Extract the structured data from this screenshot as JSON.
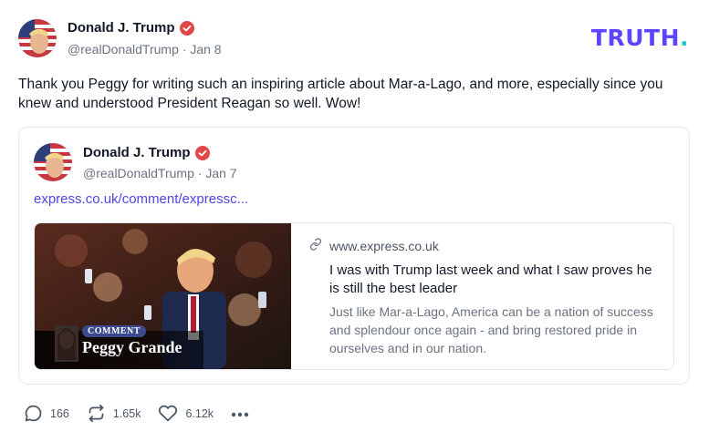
{
  "author": {
    "name": "Donald J. Trump",
    "handle": "@realDonaldTrump",
    "separator": "·",
    "date": "Jan 8"
  },
  "logo": {
    "text": "TRUTH",
    "dot": "."
  },
  "post_text": "Thank you Peggy for writing such an inspiring article about Mar-a-Lago, and more, especially since you knew and understood President Reagan so well. Wow!",
  "quoted_post": {
    "author_name": "Donald J. Trump",
    "handle": "@realDonaldTrump",
    "separator": "·",
    "date": "Jan 7",
    "link_text": "express.co.uk/comment/expressc...",
    "link_card": {
      "badge": "COMMENT",
      "byline": "Peggy Grande",
      "domain": "www.express.co.uk",
      "title": "I was with Trump last week and what I saw proves he is still the best leader",
      "description": "Just like Mar-a-Lago, America can be a nation of success and splendour once again - and bring restored pride in ourselves and in our nation."
    }
  },
  "actions": {
    "replies": "166",
    "retruths": "1.65k",
    "likes": "6.12k"
  },
  "colors": {
    "logo": "#5b45ff",
    "logo_dot": "#22c7c7",
    "link": "#4f46e5",
    "verified": "#e04848"
  },
  "icons": [
    "verified-badge-icon",
    "link-icon",
    "reply-icon",
    "retruth-icon",
    "heart-icon",
    "more-icon"
  ]
}
